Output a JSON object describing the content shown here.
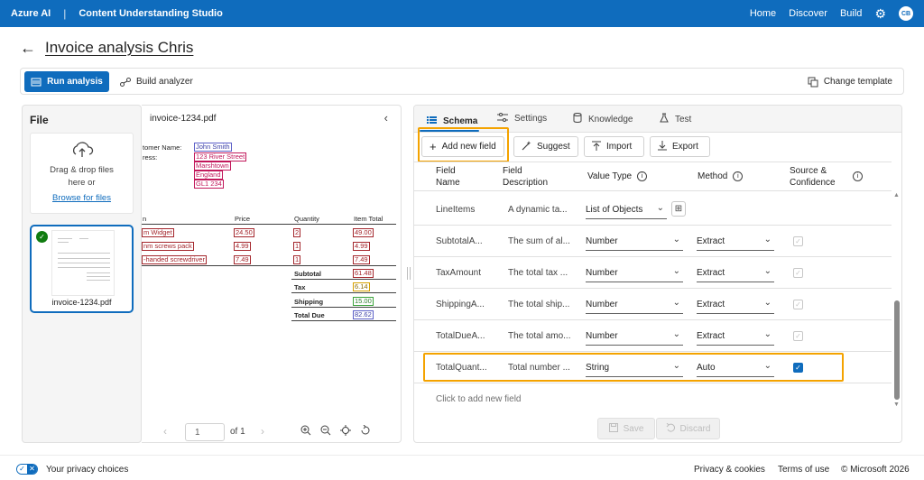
{
  "topbar": {
    "brand": "Azure AI",
    "separator": "|",
    "app_title": "Content Understanding Studio",
    "nav": [
      "Home",
      "Discover",
      "Build"
    ],
    "avatar": "CB"
  },
  "page": {
    "title": "Invoice analysis Chris"
  },
  "toolbar": {
    "run_label": "Run analysis",
    "build_label": "Build analyzer",
    "change_template_label": "Change template"
  },
  "file_panel": {
    "heading": "File",
    "drop_line1": "Drag & drop files",
    "drop_line2": "here or",
    "browse_link": "Browse for files",
    "thumbnail_name": "invoice-1234.pdf"
  },
  "document": {
    "file_name": "invoice-1234.pdf",
    "customer_name_label": "tomer Name:",
    "address_label": "ress:",
    "customer_name": "John Smith",
    "address_lines": [
      "123 River Street",
      "Marshtown",
      "England",
      "GL1 234"
    ],
    "table_headers": [
      "n",
      "Price",
      "Quantity",
      "Item Total"
    ],
    "items": [
      {
        "name": "m Widget",
        "price": "24.50",
        "qty": "2",
        "total": "49.00"
      },
      {
        "name": "nm screws pack",
        "price": "4.99",
        "qty": "1",
        "total": "4.99"
      },
      {
        "name": "-handed screwdriver",
        "price": "7.49",
        "qty": "1",
        "total": "7.49"
      }
    ],
    "summary": [
      {
        "label": "Subtotal",
        "value": "61.48"
      },
      {
        "label": "Tax",
        "value": "6.14"
      },
      {
        "label": "Shipping",
        "value": "15.00"
      },
      {
        "label": "Total Due",
        "value": "82.62"
      }
    ],
    "pager": {
      "page": "1",
      "of_label": "of 1"
    }
  },
  "tabs": [
    "Schema",
    "Settings",
    "Knowledge",
    "Test"
  ],
  "schema_actions": {
    "add_field": "Add new field",
    "suggest": "Suggest",
    "import": "Import",
    "export": "Export"
  },
  "table": {
    "headers": {
      "field_name_1": "Field",
      "field_name_2": "Name",
      "field_desc_1": "Field",
      "field_desc_2": "Description",
      "value_type": "Value Type",
      "method": "Method",
      "source_1": "Source &",
      "source_2": "Confidence"
    },
    "rows": [
      {
        "name": "LineItems",
        "description": "A dynamic ta...",
        "type": "List of Objects",
        "method": "",
        "checked": false
      },
      {
        "name": "SubtotalA...",
        "description": "The sum of al...",
        "type": "Number",
        "method": "Extract",
        "checked": true
      },
      {
        "name": "TaxAmount",
        "description": "The total tax ...",
        "type": "Number",
        "method": "Extract",
        "checked": true
      },
      {
        "name": "ShippingA...",
        "description": "The total ship...",
        "type": "Number",
        "method": "Extract",
        "checked": true
      },
      {
        "name": "TotalDueA...",
        "description": "The total amo...",
        "type": "Number",
        "method": "Extract",
        "checked": true
      },
      {
        "name": "TotalQuant...",
        "description": "Total number ...",
        "type": "String",
        "method": "Auto",
        "checked": true
      }
    ],
    "add_row_placeholder": "Click to add new field"
  },
  "footer_actions": {
    "save": "Save",
    "discard": "Discard"
  },
  "footer": {
    "privacy_choices": "Your privacy choices",
    "privacy_cookies": "Privacy & cookies",
    "terms": "Terms of use",
    "copyright": "© Microsoft 2026"
  },
  "colors": {
    "brand": "#0f6cbd",
    "highlight": "#f4a300"
  }
}
